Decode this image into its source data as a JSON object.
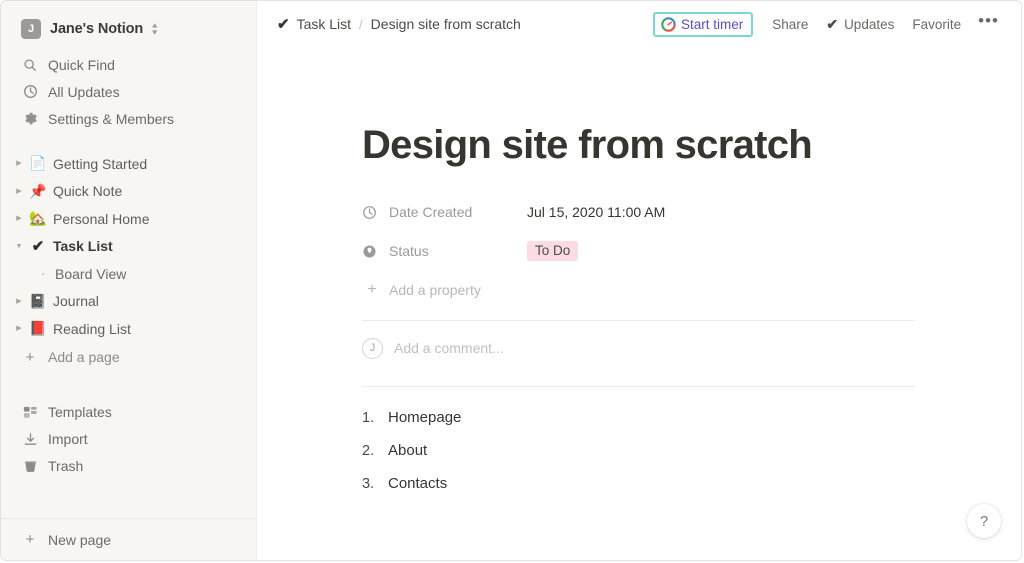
{
  "sidebar": {
    "workspace": {
      "avatar_letter": "J",
      "name": "Jane's Notion"
    },
    "nav": [
      {
        "icon": "search-icon",
        "label": "Quick Find"
      },
      {
        "icon": "clock-icon",
        "label": "All Updates"
      },
      {
        "icon": "gear-icon",
        "label": "Settings & Members"
      }
    ],
    "tree": [
      {
        "icon": "page-icon",
        "emoji": "📄",
        "label": "Getting Started",
        "expanded": false,
        "selected": false
      },
      {
        "icon": "pushpin-icon",
        "emoji": "📌",
        "label": "Quick Note",
        "expanded": false,
        "selected": false
      },
      {
        "icon": "house-icon",
        "emoji": "🏡",
        "label": "Personal Home",
        "expanded": false,
        "selected": false
      },
      {
        "icon": "checkmark-icon",
        "emoji": "✔",
        "label": "Task List",
        "expanded": true,
        "selected": true
      },
      {
        "icon": "notebook-icon",
        "emoji": "📓",
        "label": "Journal",
        "expanded": false,
        "selected": false
      },
      {
        "icon": "closed-book-icon",
        "emoji": "📕",
        "label": "Reading List",
        "expanded": false,
        "selected": false
      }
    ],
    "sub_item": {
      "label": "Board View"
    },
    "add_page": {
      "label": "Add a page"
    },
    "bottom": [
      {
        "icon": "templates-icon",
        "label": "Templates"
      },
      {
        "icon": "import-icon",
        "label": "Import"
      },
      {
        "icon": "trash-icon",
        "label": "Trash"
      }
    ],
    "new_page": {
      "label": "New page"
    }
  },
  "topbar": {
    "breadcrumb_parent": "Task List",
    "breadcrumb_separator": "/",
    "breadcrumb_current": "Design site from scratch",
    "start_timer": {
      "label": "Start timer",
      "focus_ring_color": "#7fd4d8",
      "text_color": "#5b4fc4"
    },
    "share": "Share",
    "updates": "Updates",
    "favorite": "Favorite",
    "more": "•••"
  },
  "page": {
    "title": "Design site from scratch",
    "properties": [
      {
        "icon": "clock-icon",
        "name": "Date Created",
        "value": "Jul 15, 2020 11:00 AM",
        "type": "text"
      },
      {
        "icon": "status-icon",
        "name": "Status",
        "value": "To Do",
        "type": "pill",
        "pill_bg": "#fadce2",
        "pill_fg": "#4c4b48"
      }
    ],
    "add_property": "Add a property",
    "comment": {
      "avatar_letter": "J",
      "placeholder": "Add a comment..."
    },
    "numbered_list": [
      {
        "number": "1.",
        "text": "Homepage"
      },
      {
        "number": "2.",
        "text": "About"
      },
      {
        "number": "3.",
        "text": "Contacts"
      }
    ]
  },
  "help": {
    "label": "?"
  }
}
